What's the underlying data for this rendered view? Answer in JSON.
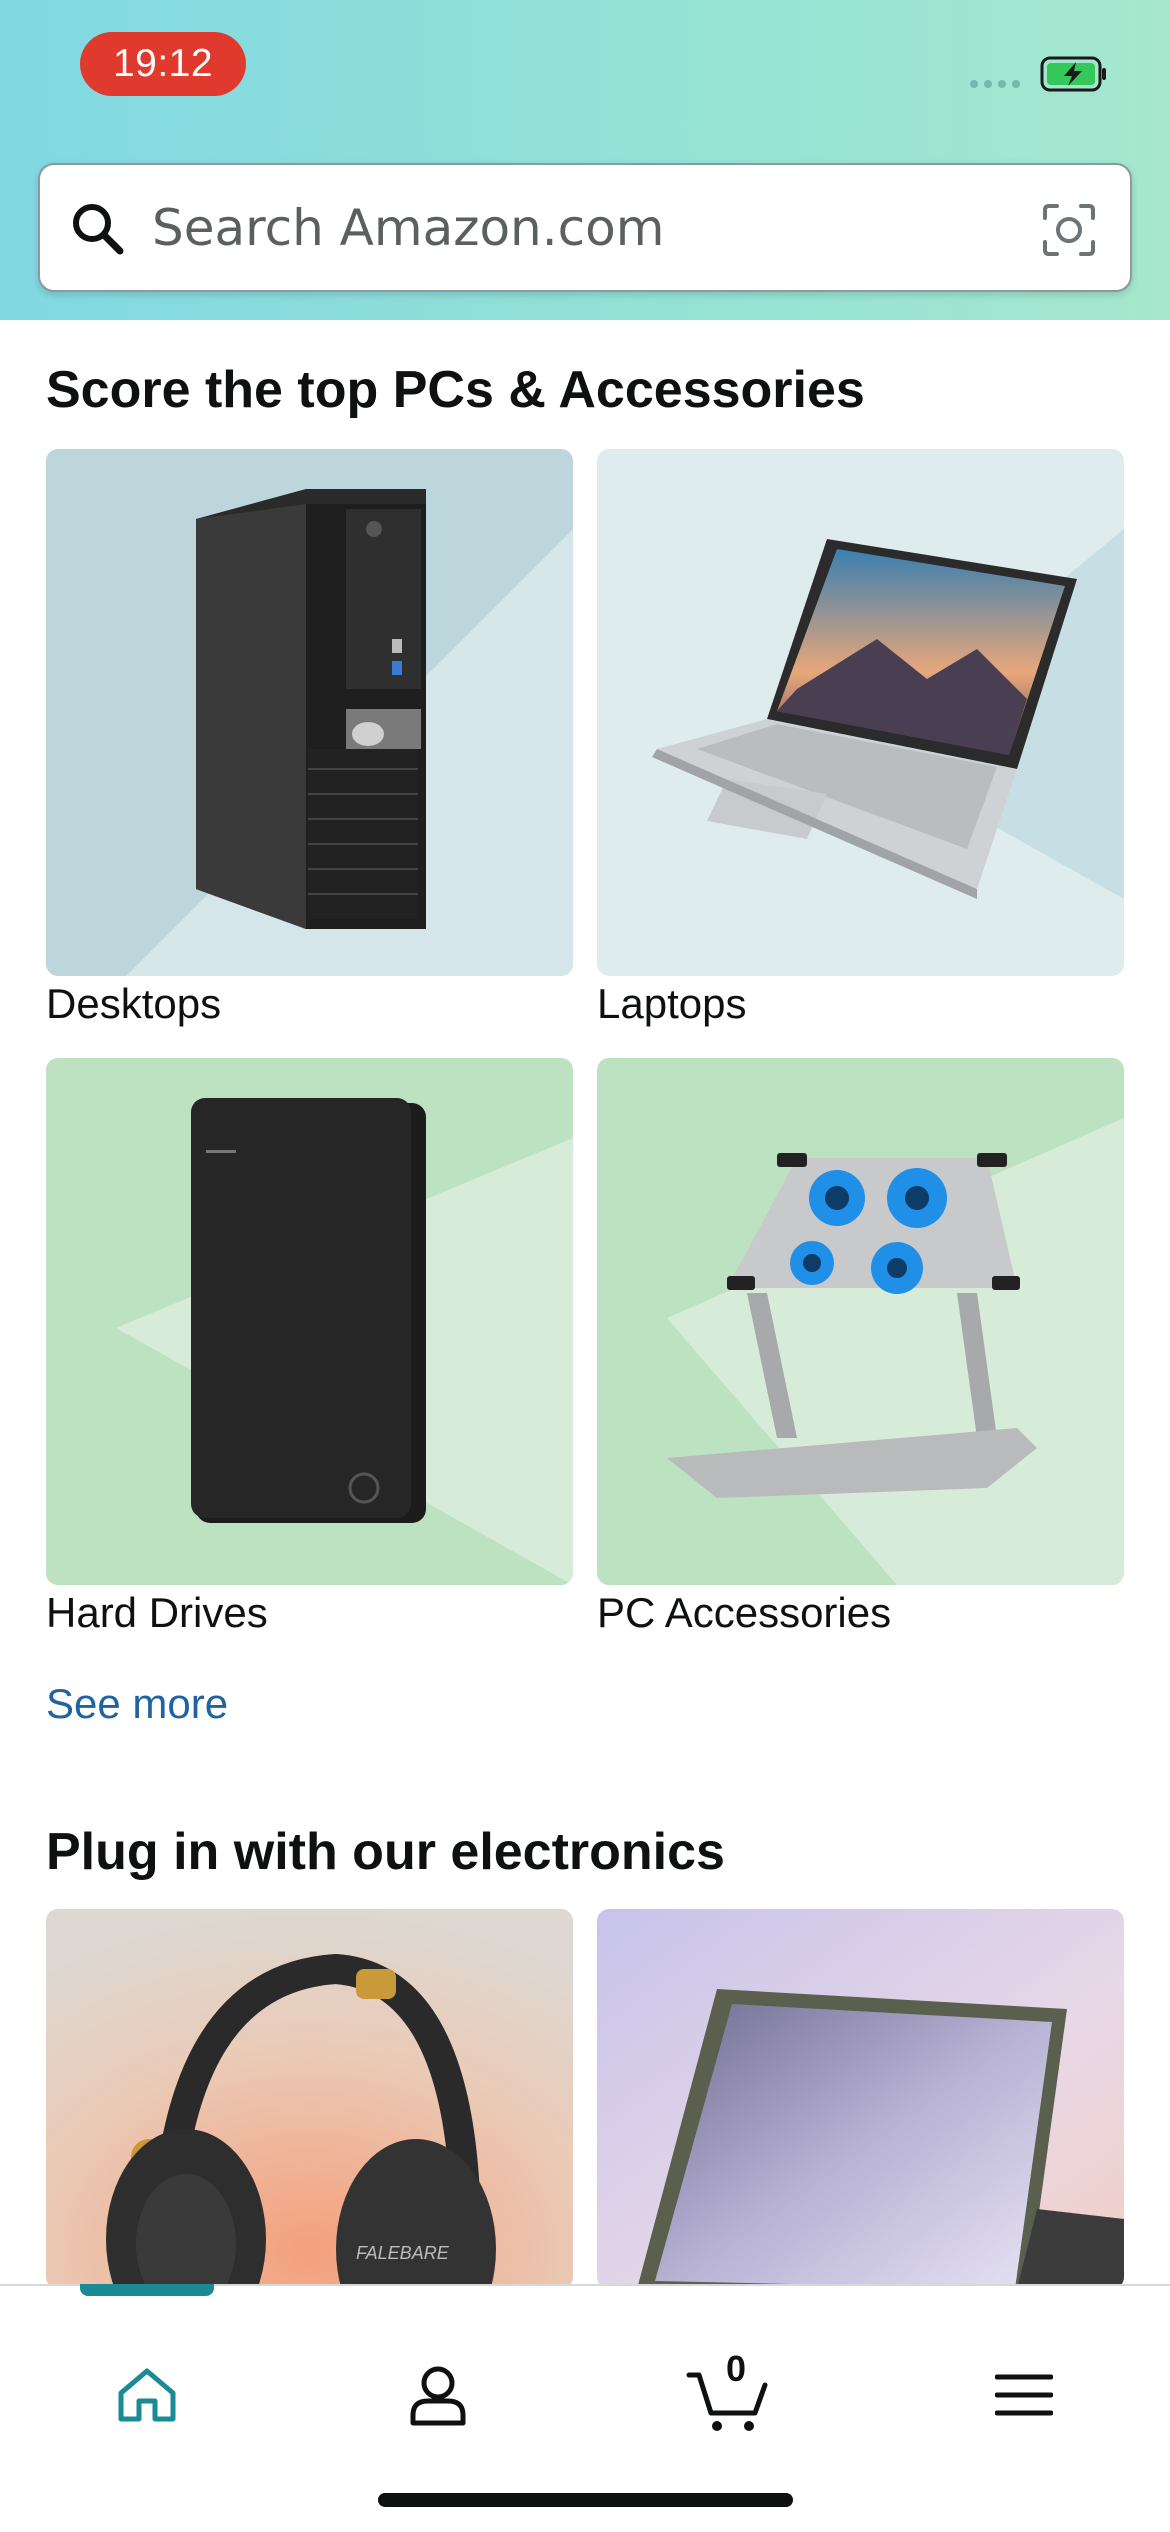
{
  "status_bar": {
    "time": "19:12"
  },
  "search": {
    "placeholder": "Search Amazon.com",
    "value": ""
  },
  "section1": {
    "title": "Score the top PCs & Accessories",
    "tiles": [
      {
        "label": "Desktops"
      },
      {
        "label": "Laptops"
      },
      {
        "label": "Hard Drives"
      },
      {
        "label": "PC Accessories"
      }
    ],
    "see_more": "See more"
  },
  "section2": {
    "title": "Plug in with our electronics",
    "headphone_brand": "FALEBARE"
  },
  "bottom_nav": {
    "items": [
      "home-icon",
      "account-icon",
      "cart-icon",
      "menu-icon"
    ],
    "cart_count": "0",
    "active": "home"
  },
  "colors": {
    "header_gradient": [
      "#82d8e3",
      "#a6e7ce"
    ],
    "accent": "#1a8a95",
    "link": "#2162a1",
    "time_pill": "#e0392d"
  }
}
